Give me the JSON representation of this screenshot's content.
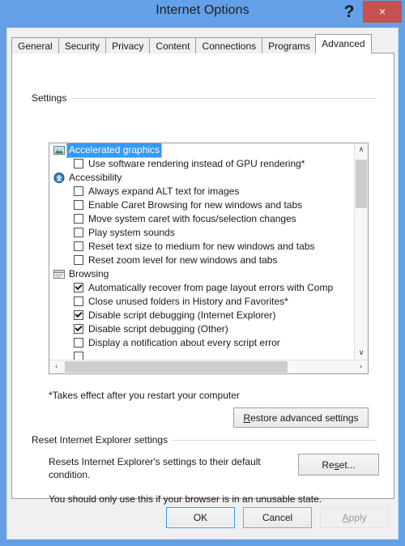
{
  "window": {
    "title": "Internet Options",
    "help_icon": "?",
    "close_icon": "×",
    "frame_color": "#63a0e8",
    "close_button_color": "#c75050"
  },
  "tabs": [
    {
      "label": "General",
      "active": false
    },
    {
      "label": "Security",
      "active": false
    },
    {
      "label": "Privacy",
      "active": false
    },
    {
      "label": "Content",
      "active": false
    },
    {
      "label": "Connections",
      "active": false
    },
    {
      "label": "Programs",
      "active": false
    },
    {
      "label": "Advanced",
      "active": true
    }
  ],
  "settings_group": {
    "label": "Settings",
    "items": [
      {
        "type": "category",
        "label": "Accelerated graphics",
        "icon": "graphics-icon",
        "selected": true
      },
      {
        "type": "option",
        "label": "Use software rendering instead of GPU rendering*",
        "checked": false
      },
      {
        "type": "category",
        "label": "Accessibility",
        "icon": "accessibility-icon",
        "selected": false
      },
      {
        "type": "option",
        "label": "Always expand ALT text for images",
        "checked": false
      },
      {
        "type": "option",
        "label": "Enable Caret Browsing for new windows and tabs",
        "checked": false
      },
      {
        "type": "option",
        "label": "Move system caret with focus/selection changes",
        "checked": false
      },
      {
        "type": "option",
        "label": "Play system sounds",
        "checked": false
      },
      {
        "type": "option",
        "label": "Reset text size to medium for new windows and tabs",
        "checked": false
      },
      {
        "type": "option",
        "label": "Reset zoom level for new windows and tabs",
        "checked": false
      },
      {
        "type": "category",
        "label": "Browsing",
        "icon": "browsing-icon",
        "selected": false
      },
      {
        "type": "option",
        "label": "Automatically recover from page layout errors with Comp",
        "checked": true
      },
      {
        "type": "option",
        "label": "Close unused folders in History and Favorites*",
        "checked": false
      },
      {
        "type": "option",
        "label": "Disable script debugging (Internet Explorer)",
        "checked": true
      },
      {
        "type": "option",
        "label": "Disable script debugging (Other)",
        "checked": true
      },
      {
        "type": "option",
        "label": "Display a notification about every script error",
        "checked": false
      }
    ],
    "footnote": "*Takes effect after you restart your computer",
    "restore_button": {
      "prefix": "",
      "accelerator": "R",
      "suffix": "estore advanced settings"
    }
  },
  "reset_group": {
    "label": "Reset Internet Explorer settings",
    "description": "Resets Internet Explorer's settings to their default condition.",
    "warning": "You should only use this if your browser is in an unusable state.",
    "reset_button": {
      "prefix": "Re",
      "accelerator": "s",
      "suffix": "et..."
    }
  },
  "footer": {
    "ok_label": "OK",
    "cancel_label": "Cancel",
    "apply_prefix": "",
    "apply_accelerator": "A",
    "apply_suffix": "pply",
    "apply_disabled": true
  },
  "scrollbars": {
    "vertical": {
      "up_arrow": "∧",
      "down_arrow": "∨"
    },
    "horizontal": {
      "left_arrow": "‹",
      "right_arrow": "›"
    }
  }
}
